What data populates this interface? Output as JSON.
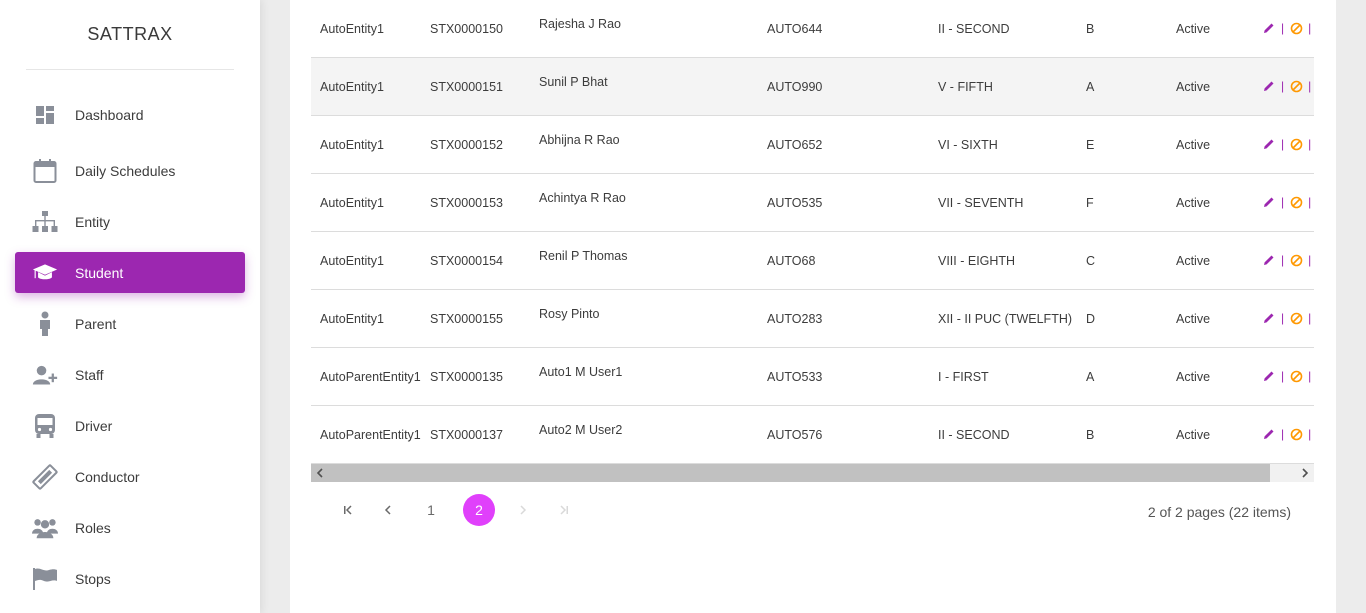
{
  "app": {
    "title": "SATTRAX"
  },
  "colors": {
    "accent": "#9c27b0",
    "page_active": "#e040fb",
    "icon_gray": "#8a8f99",
    "edit_icon": "#9c27b0",
    "block_icon": "#ff9800"
  },
  "sidebar": {
    "items": [
      {
        "label": "Dashboard",
        "icon": "dashboard-icon"
      },
      {
        "label": "Daily Schedules",
        "icon": "calendar-icon"
      },
      {
        "label": "Entity",
        "icon": "sitemap-icon"
      },
      {
        "label": "Student",
        "icon": "graduation-cap-icon",
        "active": true
      },
      {
        "label": "Parent",
        "icon": "person-icon"
      },
      {
        "label": "Staff",
        "icon": "user-plus-icon"
      },
      {
        "label": "Driver",
        "icon": "bus-icon"
      },
      {
        "label": "Conductor",
        "icon": "ticket-icon"
      },
      {
        "label": "Roles",
        "icon": "users-icon"
      },
      {
        "label": "Stops",
        "icon": "flag-icon"
      }
    ]
  },
  "table": {
    "rows": [
      {
        "entity": "AutoEntity1",
        "id": "STX0000150",
        "name": "Rajesha J Rao",
        "auto": "AUTO644",
        "class": "II - SECOND",
        "section": "B",
        "status": "Active"
      },
      {
        "entity": "AutoEntity1",
        "id": "STX0000151",
        "name": "Sunil P Bhat",
        "auto": "AUTO990",
        "class": "V - FIFTH",
        "section": "A",
        "status": "Active"
      },
      {
        "entity": "AutoEntity1",
        "id": "STX0000152",
        "name": "Abhijna R Rao",
        "auto": "AUTO652",
        "class": "VI - SIXTH",
        "section": "E",
        "status": "Active"
      },
      {
        "entity": "AutoEntity1",
        "id": "STX0000153",
        "name": "Achintya R Rao",
        "auto": "AUTO535",
        "class": "VII - SEVENTH",
        "section": "F",
        "status": "Active"
      },
      {
        "entity": "AutoEntity1",
        "id": "STX0000154",
        "name": "Renil P Thomas",
        "auto": "AUTO68",
        "class": "VIII - EIGHTH",
        "section": "C",
        "status": "Active"
      },
      {
        "entity": "AutoEntity1",
        "id": "STX0000155",
        "name": "Rosy Pinto",
        "auto": "AUTO283",
        "class": "XII - II PUC (TWELFTH)",
        "section": "D",
        "status": "Active"
      },
      {
        "entity": "AutoParentEntity1",
        "id": "STX0000135",
        "name": "Auto1 M User1",
        "auto": "AUTO533",
        "class": "I - FIRST",
        "section": "A",
        "status": "Active"
      },
      {
        "entity": "AutoParentEntity1",
        "id": "STX0000137",
        "name": "Auto2 M User2",
        "auto": "AUTO576",
        "class": "II - SECOND",
        "section": "B",
        "status": "Active"
      }
    ],
    "actions": {
      "separator": "|"
    }
  },
  "pagination": {
    "pages": [
      "1",
      "2"
    ],
    "current": "2",
    "info": "2 of 2 pages (22 items)"
  }
}
